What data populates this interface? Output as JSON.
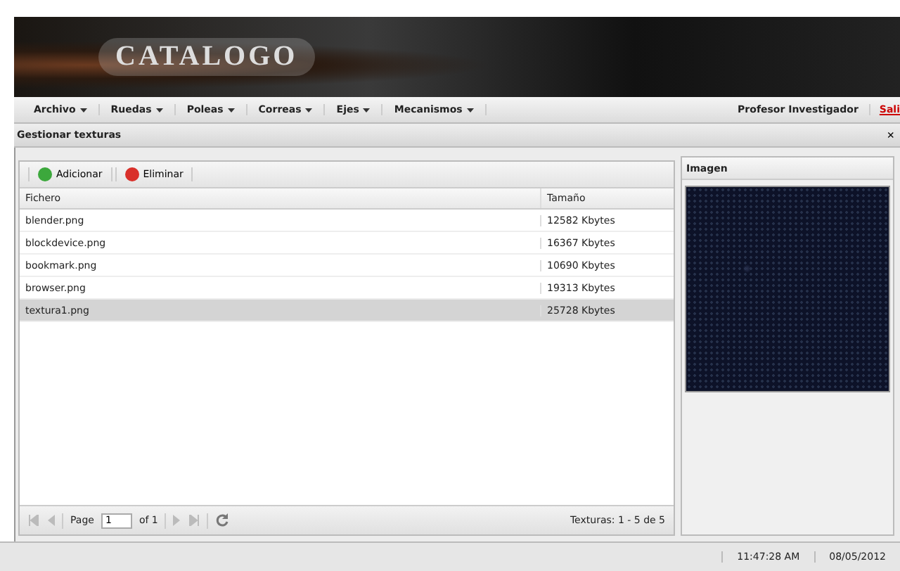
{
  "banner": {
    "logo": "CATALOGO"
  },
  "menu": [
    {
      "label": "Archivo"
    },
    {
      "label": "Ruedas"
    },
    {
      "label": "Poleas"
    },
    {
      "label": "Correas"
    },
    {
      "label": "Ejes"
    },
    {
      "label": "Mecanismos"
    }
  ],
  "user": "Profesor Investigador",
  "logout": "Sali",
  "window": {
    "title": "Gestionar texturas",
    "close": "×"
  },
  "toolbar": [
    {
      "label": "Adicionar",
      "kind": "add"
    },
    {
      "label": "Eliminar",
      "kind": "delete"
    }
  ],
  "table": {
    "columns": [
      "Fichero",
      "Tamaño"
    ],
    "rows": [
      {
        "cells": [
          "blender.png",
          "12582 Kbytes"
        ],
        "selected": false
      },
      {
        "cells": [
          "blockdevice.png",
          "16367 Kbytes"
        ],
        "selected": false
      },
      {
        "cells": [
          "bookmark.png",
          "10690 Kbytes"
        ],
        "selected": false
      },
      {
        "cells": [
          "browser.png",
          "19313 Kbytes"
        ],
        "selected": false
      },
      {
        "cells": [
          "textura1.png",
          "25728 Kbytes"
        ],
        "selected": true
      }
    ]
  },
  "pager": {
    "page_label": "Page",
    "page": "1",
    "of": "of 1",
    "summary": "Texturas: 1 - 5 de 5"
  },
  "image_panel": {
    "title": "Imagen"
  },
  "status_bar": {
    "time": "11:47:28 AM",
    "date": "08/05/2012"
  }
}
